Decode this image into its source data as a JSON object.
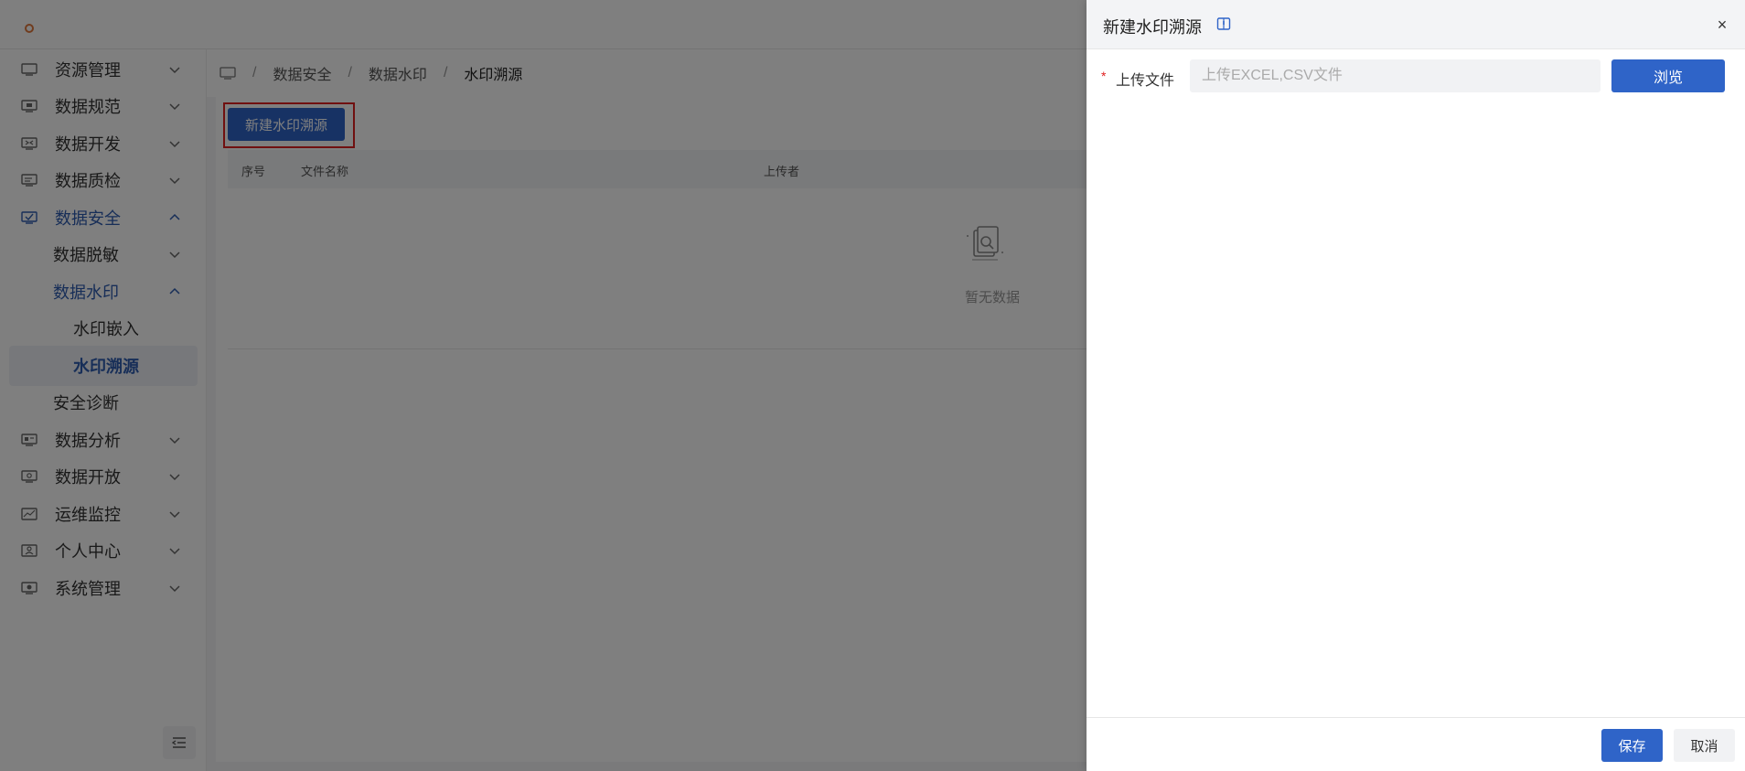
{
  "sidebar": {
    "items": [
      {
        "label": "资源管理",
        "icon": "monitor-icon",
        "expanded": false
      },
      {
        "label": "数据规范",
        "icon": "monitor-list-icon",
        "expanded": false
      },
      {
        "label": "数据开发",
        "icon": "code-screen-icon",
        "expanded": false
      },
      {
        "label": "数据质检",
        "icon": "screen-lines-icon",
        "expanded": false
      },
      {
        "label": "数据安全",
        "icon": "shield-screen-icon",
        "expanded": true,
        "active": true
      },
      {
        "label": "数据脱敏",
        "sub": true,
        "expanded": false
      },
      {
        "label": "数据水印",
        "sub": true,
        "expanded": true,
        "active": true
      },
      {
        "label": "水印嵌入",
        "sub2": true
      },
      {
        "label": "水印溯源",
        "sub2": true,
        "selected": true
      },
      {
        "label": "安全诊断",
        "sub": true
      },
      {
        "label": "数据分析",
        "icon": "chart-screen-icon",
        "expanded": false
      },
      {
        "label": "数据开放",
        "icon": "share-screen-icon",
        "expanded": false
      },
      {
        "label": "运维监控",
        "icon": "line-chart-icon",
        "expanded": false
      },
      {
        "label": "个人中心",
        "icon": "user-card-icon",
        "expanded": false
      },
      {
        "label": "系统管理",
        "icon": "settings-screen-icon",
        "expanded": false
      }
    ]
  },
  "breadcrumb": {
    "home_icon": "monitor-icon",
    "items": [
      "数据安全",
      "数据水印",
      "水印溯源"
    ],
    "separator": "/"
  },
  "toolbar": {
    "new_button_label": "新建水印溯源"
  },
  "table": {
    "columns": [
      "序号",
      "文件名称",
      "上传者"
    ],
    "empty_text": "暂无数据"
  },
  "drawer": {
    "title": "新建水印溯源",
    "close_symbol": "×",
    "upload_label": "上传文件",
    "required_mark": "*",
    "upload_placeholder": "上传EXCEL,CSV文件",
    "browse_label": "浏览",
    "save_label": "保存",
    "cancel_label": "取消"
  },
  "colors": {
    "primary": "#2f64c8",
    "active_text": "#2f5db0",
    "highlight": "#e02020"
  }
}
